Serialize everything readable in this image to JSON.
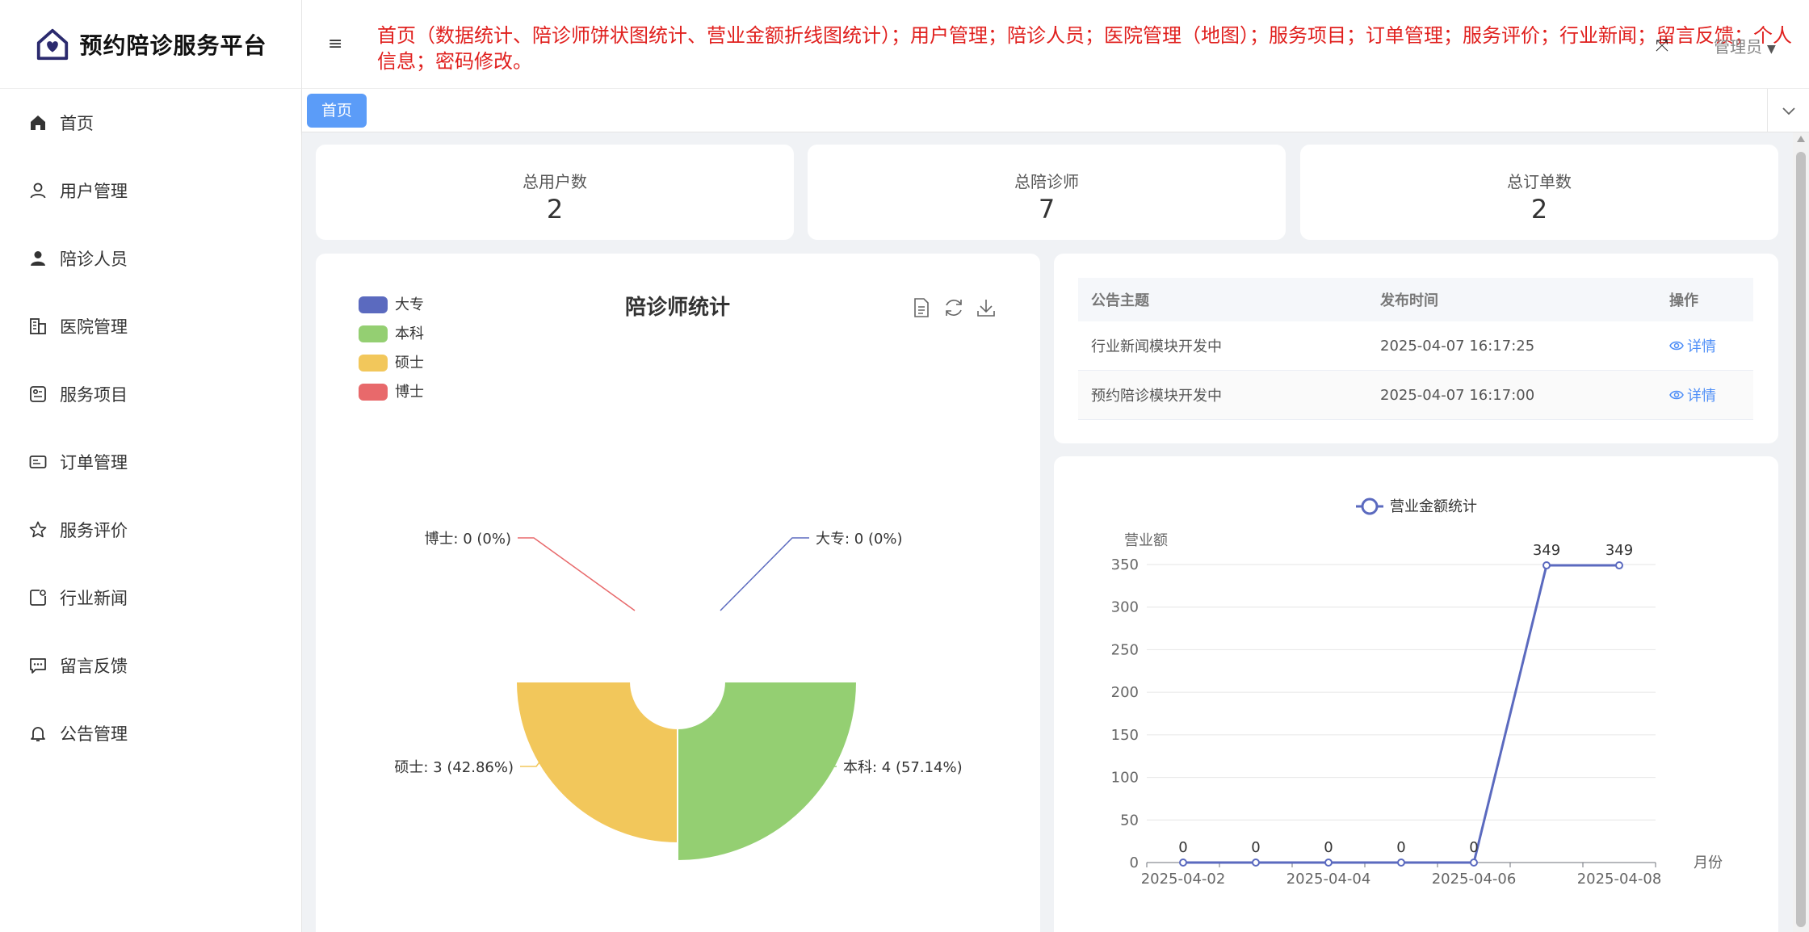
{
  "brand": {
    "title": "预约陪诊服务平台"
  },
  "sidebar": {
    "items": [
      {
        "label": "首页",
        "icon": "home-icon"
      },
      {
        "label": "用户管理",
        "icon": "user-icon"
      },
      {
        "label": "陪诊人员",
        "icon": "person-icon"
      },
      {
        "label": "医院管理",
        "icon": "building-icon"
      },
      {
        "label": "服务项目",
        "icon": "service-icon"
      },
      {
        "label": "订单管理",
        "icon": "order-icon"
      },
      {
        "label": "服务评价",
        "icon": "star-icon"
      },
      {
        "label": "行业新闻",
        "icon": "news-icon"
      },
      {
        "label": "留言反馈",
        "icon": "message-icon"
      },
      {
        "label": "公告管理",
        "icon": "bell-icon"
      }
    ]
  },
  "header": {
    "notice": "首页（数据统计、陪诊师饼状图统计、营业金额折线图统计）；用户管理；陪诊人员；医院管理（地图）；服务项目；订单管理；服务评价；行业新闻；留言反馈；个人信息；密码修改。",
    "user": "管理员",
    "hamburger_icon": "≡",
    "fullscreen_icon": "⤧"
  },
  "tabs": {
    "home": "首页"
  },
  "stats": [
    {
      "label": "总用户数",
      "value": "2"
    },
    {
      "label": "总陪诊师",
      "value": "7"
    },
    {
      "label": "总订单数",
      "value": "2"
    }
  ],
  "pie_chart": {
    "title": "陪诊师统计",
    "legend": [
      "大专",
      "本科",
      "硕士",
      "博士"
    ],
    "labels": [
      "大专: 0 (0%)",
      "本科: 4 (57.14%)",
      "硕士: 3 (42.86%)",
      "博士: 0 (0%)"
    ],
    "colors": [
      "#5b6abf",
      "#94cf72",
      "#f2c75b",
      "#e8696b"
    ]
  },
  "notices_table": {
    "headers": [
      "公告主题",
      "发布时间",
      "操作"
    ],
    "rows": [
      {
        "title": "行业新闻模块开发中",
        "time": "2025-04-07 16:17:25",
        "action": "详情"
      },
      {
        "title": "预约陪诊模块开发中",
        "time": "2025-04-07 16:17:00",
        "action": "详情"
      }
    ]
  },
  "line_chart": {
    "legend": "营业金额统计",
    "ylabel": "营业额",
    "xlabel": "月份",
    "y_ticks": [
      "0",
      "50",
      "100",
      "150",
      "200",
      "250",
      "300",
      "350"
    ],
    "x_ticks": [
      "2025-04-02",
      "2025-04-04",
      "2025-04-06",
      "2025-04-08"
    ],
    "color": "#5b6abf"
  },
  "chart_data": [
    {
      "type": "pie",
      "title": "陪诊师统计",
      "categories": [
        "大专",
        "本科",
        "硕士",
        "博士"
      ],
      "values": [
        0,
        4,
        3,
        0
      ],
      "percentages": [
        "0%",
        "57.14%",
        "42.86%",
        "0%"
      ],
      "legend_position": "top-left"
    },
    {
      "type": "line",
      "title": "",
      "series": [
        {
          "name": "营业金额统计",
          "x": [
            "2025-04-02",
            "2025-04-03",
            "2025-04-04",
            "2025-04-05",
            "2025-04-06",
            "2025-04-07",
            "2025-04-08"
          ],
          "values": [
            0,
            0,
            0,
            0,
            0,
            349,
            349
          ]
        }
      ],
      "xlabel": "月份",
      "ylabel": "营业额",
      "ylim": [
        0,
        350
      ],
      "grid": true,
      "legend_position": "top-center"
    }
  ]
}
